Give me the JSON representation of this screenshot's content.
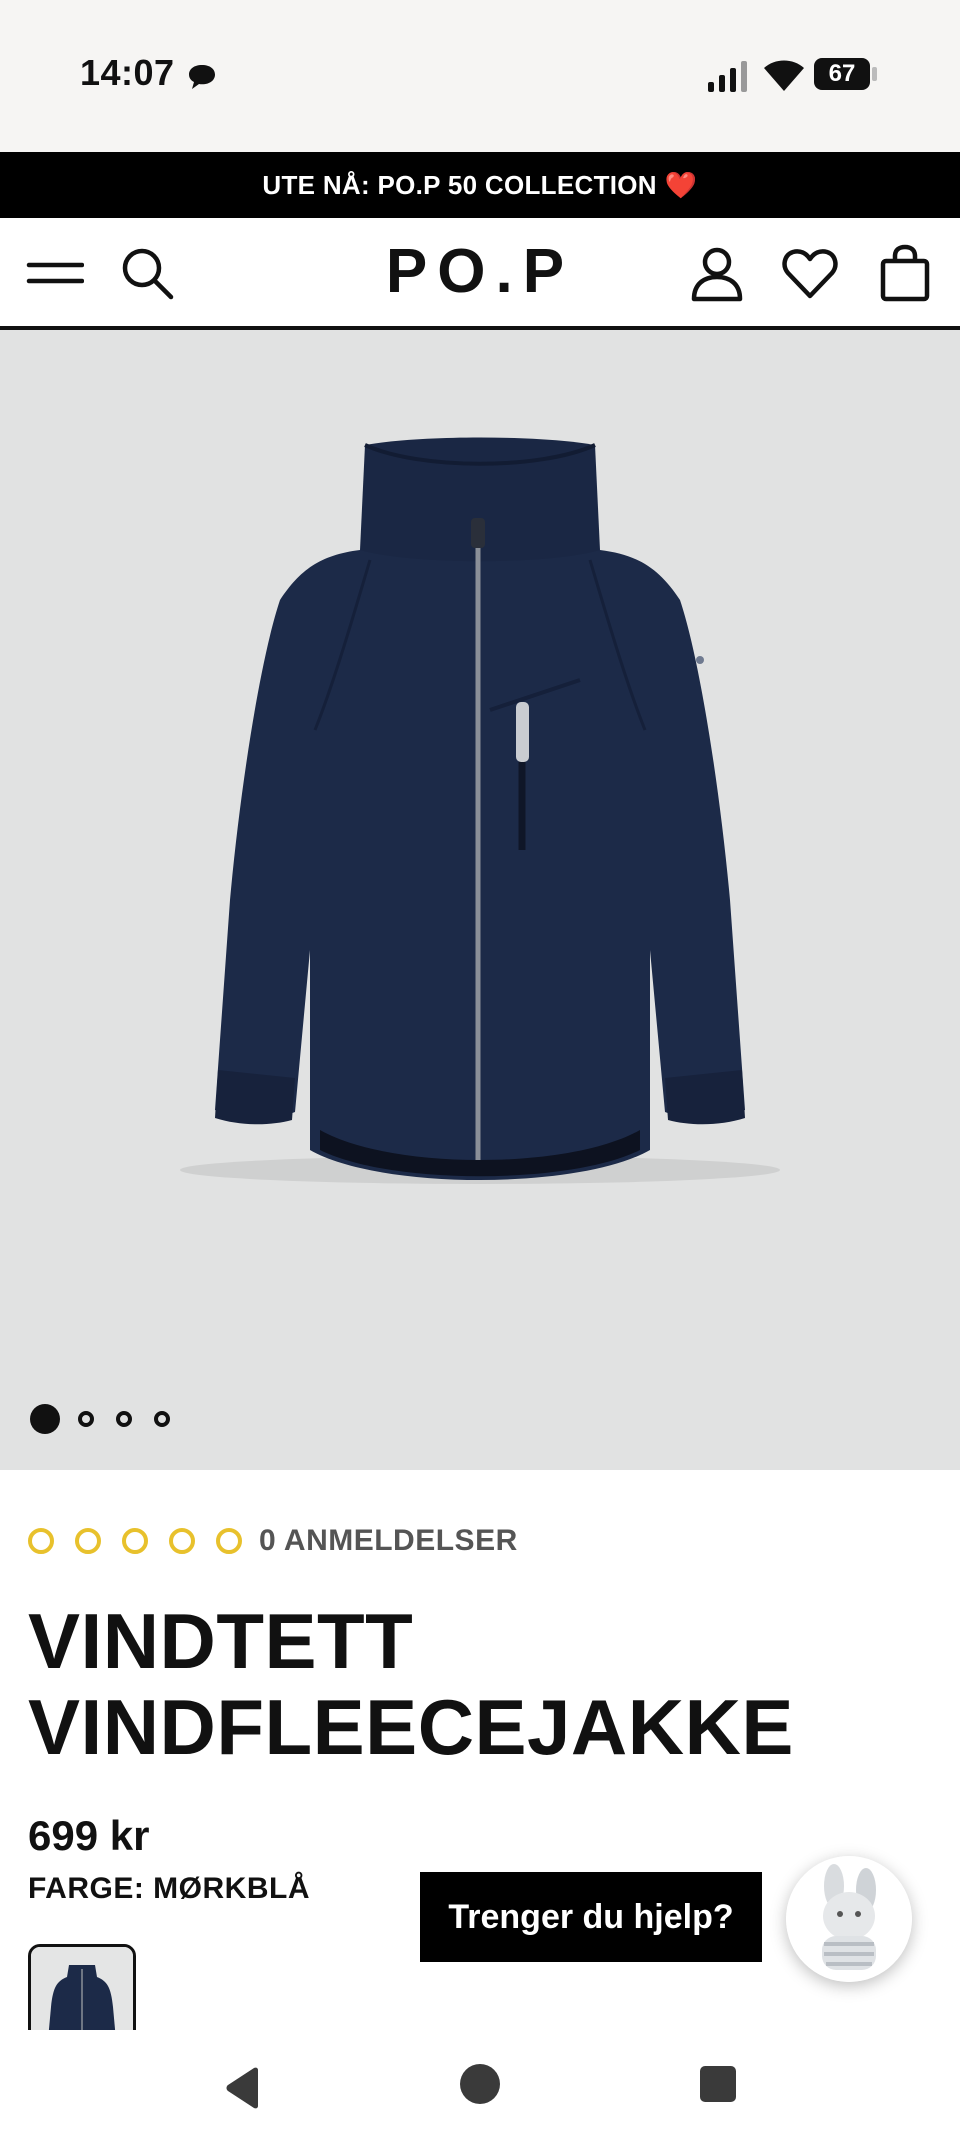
{
  "status_bar": {
    "time": "14:07",
    "battery": "67",
    "icons": [
      "chat-icon",
      "signal-icon",
      "wifi-icon",
      "battery-icon"
    ]
  },
  "promo": {
    "text": "UTE NÅ: PO.P 50 COLLECTION",
    "emoji": "❤️"
  },
  "header": {
    "logo": "PO.P",
    "icons": [
      "menu-icon",
      "search-icon",
      "account-icon",
      "heart-icon",
      "bag-icon"
    ]
  },
  "gallery": {
    "slide_count": 4,
    "active_index": 0,
    "background": "#e1e2e2",
    "product_color": "#1c2a48"
  },
  "product": {
    "rating": 0,
    "rating_max": 5,
    "reviews": "0 ANMELDELSER",
    "title_line1": "VINDTETT",
    "title_line2": "VINDFLEECEJAKKE",
    "price": "699 kr",
    "color_label": "FARGE: MØRKBLÅ"
  },
  "help": {
    "button_label": "Trenger du hjelp?"
  },
  "colors": {
    "accent_star": "#e8c12c",
    "promo_bg": "#000000",
    "text": "#111111"
  },
  "system_nav": [
    "back-icon",
    "home-icon",
    "recents-icon"
  ]
}
